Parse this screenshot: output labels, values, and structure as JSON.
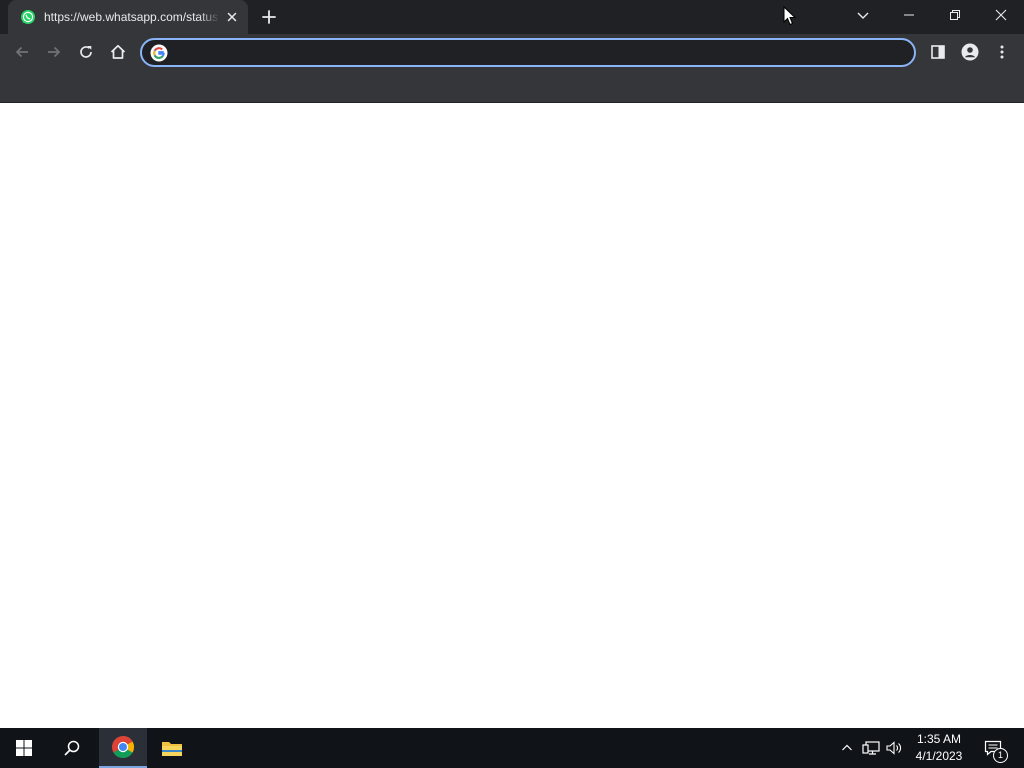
{
  "browser": {
    "tab": {
      "title": "https://web.whatsapp.com/status",
      "favicon": "whatsapp-icon"
    },
    "address_bar": {
      "value": "",
      "placeholder": "",
      "leading_icon": "google-icon"
    },
    "colors": {
      "frame": "#202124",
      "toolbar": "#35363a",
      "focus_ring": "#8ab4f8",
      "whatsapp_green": "#25d366"
    }
  },
  "taskbar": {
    "items": [
      "windows-start-icon",
      "search-icon",
      "chrome-icon",
      "file-explorer-icon"
    ],
    "tray_icons": [
      "chevron-up-icon",
      "network-icon",
      "volume-icon"
    ],
    "clock": {
      "time": "1:35 AM",
      "date": "4/1/2023"
    },
    "notification_count": "1"
  }
}
